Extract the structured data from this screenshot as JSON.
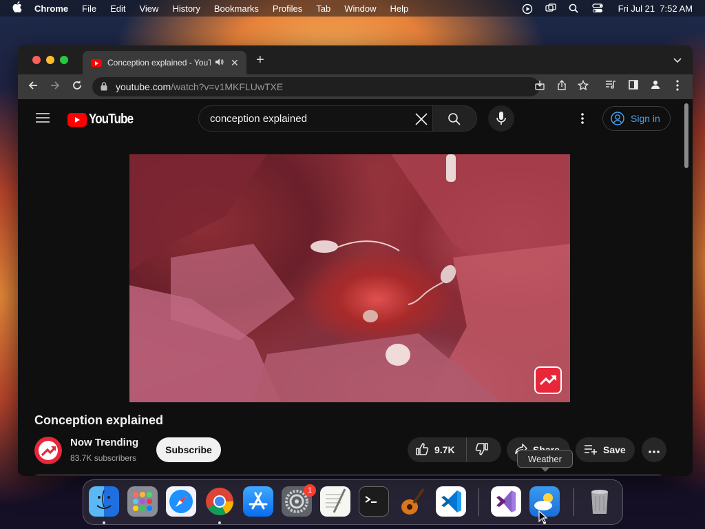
{
  "menubar": {
    "app_name": "Chrome",
    "items": [
      "File",
      "Edit",
      "View",
      "History",
      "Bookmarks",
      "Profiles",
      "Tab",
      "Window",
      "Help"
    ],
    "clock": "Fri Jul 21  7:52 AM"
  },
  "browser": {
    "tab_title": "Conception explained - YouTube",
    "url_host": "youtube.com",
    "url_path": "/watch?v=v1MKFLUwTXE"
  },
  "youtube": {
    "logo_text": "YouTube",
    "search_value": "conception explained",
    "sign_in_label": "Sign in",
    "video_title": "Conception explained",
    "channel_name": "Now Trending",
    "subscribers": "83.7K subscribers",
    "subscribe_label": "Subscribe",
    "like_count": "9.7K",
    "share_label": "Share",
    "save_label": "Save"
  },
  "dock": {
    "tooltip": "Weather",
    "badge_count": "1",
    "apps": [
      "finder-icon",
      "launchpad-icon",
      "safari-icon",
      "chrome-icon",
      "app-store-icon",
      "system-settings-icon",
      "textedit-icon",
      "terminal-icon",
      "garageband-icon",
      "vscode-icon",
      "visual-studio-icon",
      "weather-icon",
      "trash-icon"
    ]
  },
  "colors": {
    "youtube_red": "#ff0000",
    "link_blue": "#3ea6ff",
    "channel_accent": "#e8273a"
  }
}
